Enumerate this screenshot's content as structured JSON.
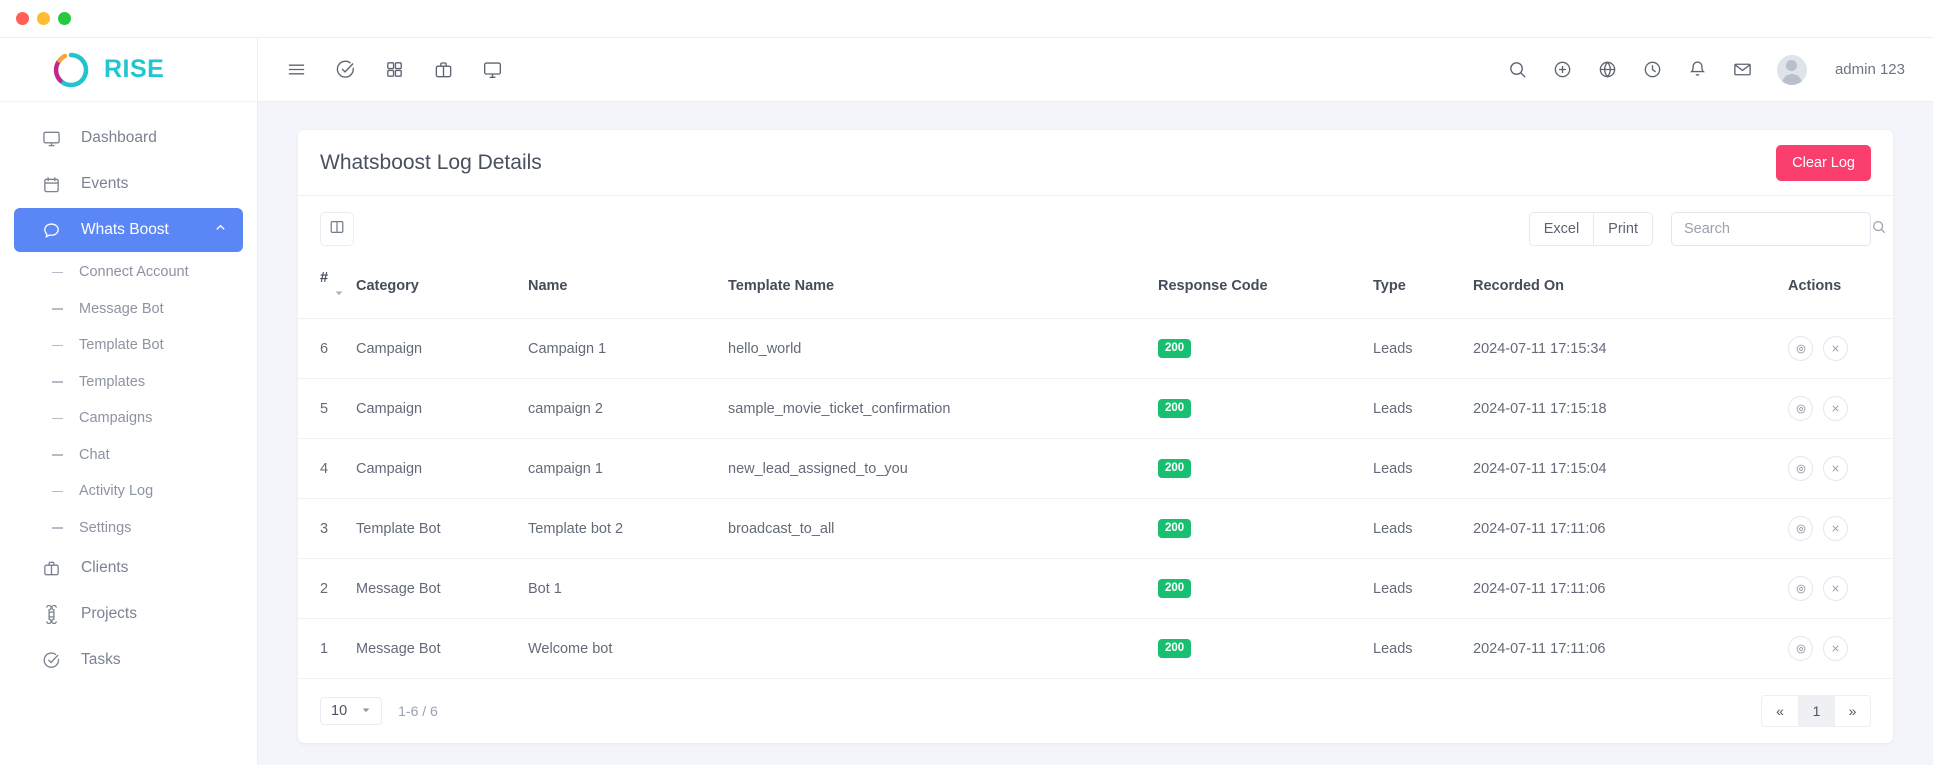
{
  "window": {
    "traffic_lights": [
      "close",
      "minimize",
      "maximize"
    ]
  },
  "brand": {
    "name": "RISE",
    "logo": "rise-logo",
    "color": "#21c6cf"
  },
  "sidebar": {
    "items": [
      {
        "label": "Dashboard",
        "icon": "monitor-icon",
        "active": false
      },
      {
        "label": "Events",
        "icon": "calendar-icon",
        "active": false
      },
      {
        "label": "Whats Boost",
        "icon": "chat-bubble-icon",
        "active": true,
        "expanded": true
      },
      {
        "label": "Clients",
        "icon": "briefcase-icon",
        "active": false
      },
      {
        "label": "Projects",
        "icon": "command-icon",
        "active": false
      },
      {
        "label": "Tasks",
        "icon": "check-circle-icon",
        "active": false
      }
    ],
    "sub_items": [
      {
        "label": "Connect Account"
      },
      {
        "label": "Message Bot"
      },
      {
        "label": "Template Bot"
      },
      {
        "label": "Templates"
      },
      {
        "label": "Campaigns"
      },
      {
        "label": "Chat"
      },
      {
        "label": "Activity Log"
      },
      {
        "label": "Settings"
      }
    ],
    "active_color": "#5b86f5"
  },
  "topbar": {
    "left_icons": [
      "hamburger-icon",
      "check-circle-icon",
      "grid-icon",
      "briefcase-icon",
      "monitor-icon"
    ],
    "right_icons": [
      "search-icon",
      "plus-circle-icon",
      "globe-icon",
      "clock-icon",
      "bell-icon",
      "mail-icon"
    ],
    "username": "admin 123"
  },
  "card": {
    "title": "Whatsboost Log Details",
    "clear_log_label": "Clear Log",
    "clear_log_color": "#fa3e6e",
    "column_toggle_icon": "columns-icon",
    "excel_label": "Excel",
    "print_label": "Print",
    "search_placeholder": "Search",
    "search_value": ""
  },
  "table": {
    "columns": [
      "#",
      "Category",
      "Name",
      "Template Name",
      "Response Code",
      "Type",
      "Recorded On",
      "Actions"
    ],
    "rows": [
      {
        "num": "6",
        "category": "Campaign",
        "name": "Campaign 1",
        "template": "hello_world",
        "code": "200",
        "type": "Leads",
        "recorded": "2024-07-11 17:15:34"
      },
      {
        "num": "5",
        "category": "Campaign",
        "name": "campaign 2",
        "template": "sample_movie_ticket_confirmation",
        "code": "200",
        "type": "Leads",
        "recorded": "2024-07-11 17:15:18"
      },
      {
        "num": "4",
        "category": "Campaign",
        "name": "campaign 1",
        "template": "new_lead_assigned_to_you",
        "code": "200",
        "type": "Leads",
        "recorded": "2024-07-11 17:15:04"
      },
      {
        "num": "3",
        "category": "Template Bot",
        "name": "Template bot 2",
        "template": "broadcast_to_all",
        "code": "200",
        "type": "Leads",
        "recorded": "2024-07-11 17:11:06"
      },
      {
        "num": "2",
        "category": "Message Bot",
        "name": "Bot 1",
        "template": "",
        "code": "200",
        "type": "Leads",
        "recorded": "2024-07-11 17:11:06"
      },
      {
        "num": "1",
        "category": "Message Bot",
        "name": "Welcome bot",
        "template": "",
        "code": "200",
        "type": "Leads",
        "recorded": "2024-07-11 17:11:06"
      }
    ],
    "badge_color": "#18bf71",
    "row_actions": [
      "view-icon",
      "delete-icon"
    ]
  },
  "footer": {
    "page_size": "10",
    "range": "1-6 / 6",
    "prev_label": "«",
    "current_page": "1",
    "next_label": "»"
  }
}
